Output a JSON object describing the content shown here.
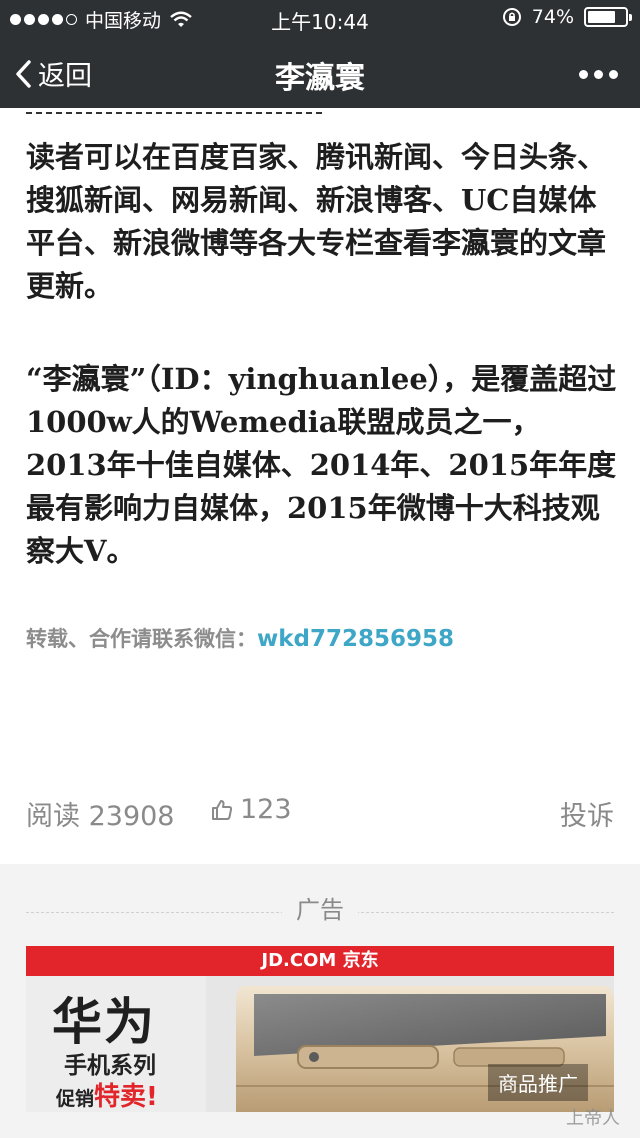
{
  "status_bar": {
    "carrier": "中国移动",
    "time": "上午10:44",
    "battery_percent": "74%",
    "battery_level": 0.74
  },
  "nav": {
    "back_label": "返回",
    "title": "李瀛寰"
  },
  "article": {
    "paragraph1": "读者可以在百度百家、腾讯新闻、今日头条、搜狐新闻、网易新闻、新浪博客、UC自媒体平台、新浪微博等各大专栏查看李瀛寰的文章更新。",
    "paragraph2": "“李瀛寰”（ID：yinghuanlee），是覆盖超过1000w人的Wemedia联盟成员之一，2013年十佳自媒体、2014年、2015年年度最有影响力自媒体，2015年微博十大科技观察大V。",
    "contact_label": "转载、合作请联系微信：",
    "contact_wechat": "wkd772856958"
  },
  "meta": {
    "read_label": "阅读 23908",
    "like_count": "123",
    "report_label": "投诉"
  },
  "ad": {
    "section_label": "广告",
    "topbar": "JD.COM 京东",
    "brand": "华为",
    "series": "手机系列",
    "sale_prefix": "促销",
    "sale_highlight": "特卖",
    "sale_suffix": "!",
    "tag": "商品推广",
    "watermark": "上帝人"
  },
  "colors": {
    "bar_bg": "#2e3134",
    "link": "#3ea6c6",
    "jd_red": "#e1252b"
  }
}
